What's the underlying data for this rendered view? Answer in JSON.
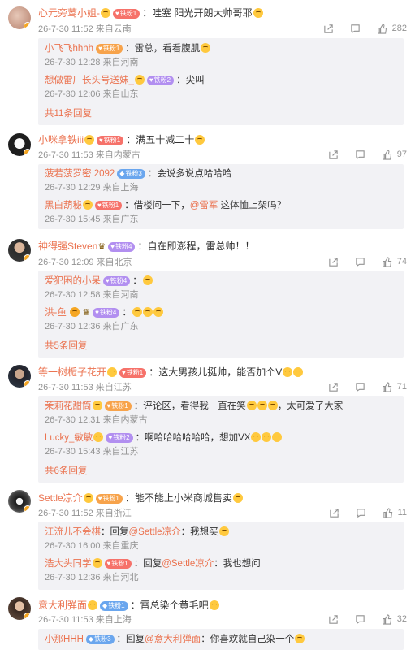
{
  "comments": [
    {
      "user": "心元旁莺小姐-",
      "badge": "铁粉1",
      "text": "：哇塞 阳光开朗大帅哥耶",
      "date": "26-7-30 11:52",
      "location": "来自云南",
      "likes": "282",
      "replies": [
        {
          "user": "小飞飞hhhh",
          "badge": "铁粉1",
          "text": "：雷总，看看腹肌",
          "date": "26-7-30 12:28",
          "location": "来自河南"
        },
        {
          "user": "想做雷厂长头号送妹_",
          "badge": "铁粉2",
          "text": "：尖叫",
          "date": "26-7-30 12:06",
          "location": "来自山东"
        }
      ],
      "more": "共11条回复"
    },
    {
      "user": "小咪拿铁iii",
      "badge": "铁粉1",
      "text": "：满五十减二十",
      "date": "26-7-30 11:53",
      "location": "来自内蒙古",
      "likes": "97",
      "replies": [
        {
          "user": "菠若菠罗密 2092",
          "badge": "铁粉3",
          "text": "：会说多说点哈哈哈",
          "date": "26-7-30 12:29",
          "location": "来自上海"
        },
        {
          "user": "黑白葫秘",
          "badge": "铁粉1",
          "text": "：借楼问一下，",
          "mention": "@雷军",
          "text2": " 这体恤上架吗？",
          "date": "26-7-30 15:45",
          "location": "来自广东"
        }
      ]
    },
    {
      "user": "神得强Steven",
      "badge": "铁粉4",
      "text": "：自在即澎程，雷总帅！！",
      "date": "26-7-30 12:09",
      "location": "来自北京",
      "likes": "74",
      "replies": [
        {
          "user": "爱犯困的小呆",
          "badge": "铁粉4",
          "text": "：",
          "date": "26-7-30 12:58",
          "location": "来自河南"
        },
        {
          "user": "洪-鱼",
          "badge": "铁粉4",
          "text": "：",
          "date": "26-7-30 12:36",
          "location": "来自广东"
        }
      ],
      "more": "共5条回复"
    },
    {
      "user": "等一树栀子花开",
      "badge": "铁粉1",
      "text": "：这大男孩儿挺帅，能否加个V",
      "date": "26-7-30 11:53",
      "location": "来自江苏",
      "likes": "71",
      "replies": [
        {
          "user": "茉莉花甜筒",
          "badge": "铁粉1",
          "text": "：评论区，看得我一直在笑",
          "text2": "，太可爱了大家",
          "date": "26-7-30 12:31",
          "location": "来自内蒙古"
        },
        {
          "user": "Lucky_敏敏",
          "badge": "铁粉2",
          "text": "：啊哈哈哈哈哈哈，想加VX",
          "date": "26-7-30 15:43",
          "location": "来自江苏"
        }
      ],
      "more": "共6条回复"
    },
    {
      "user": "Settle凉介",
      "badge": "铁粉1",
      "text": "：能不能上小米商城售卖",
      "date": "26-7-30 11:52",
      "location": "来自浙江",
      "likes": "11",
      "replies": [
        {
          "user": "江流儿不会棋",
          "badge": "",
          "text": "：回复",
          "mention": "@Settle凉介",
          "text2": "：我想买",
          "date": "26-7-30 16:00",
          "location": "来自重庆"
        },
        {
          "user": "浩大头同学",
          "badge": "铁粉1",
          "text": "：回复",
          "mention": "@Settle凉介",
          "text2": "：我也想问",
          "date": "26-7-30 12:36",
          "location": "来自河北"
        }
      ]
    },
    {
      "user": "意大利弹面",
      "badge": "铁粉1",
      "text": "：雷总染个黄毛吧",
      "date": "26-7-30 11:53",
      "location": "来自上海",
      "likes": "32",
      "replies": [
        {
          "user": "小那HHH",
          "badge": "铁粉3",
          "text": "：回复",
          "mention": "@意大利弹面",
          "text2": "：你喜欢就自己染一个",
          "date": "",
          "location": ""
        }
      ]
    }
  ],
  "colors": {
    "username": "#eb7350",
    "meta": "#939393",
    "reply_bg": "#f2f2f5"
  },
  "icons": [
    "share-icon",
    "comment-icon",
    "like-icon",
    "verified-badge-icon",
    "emoji-icon",
    "crown-icon"
  ]
}
